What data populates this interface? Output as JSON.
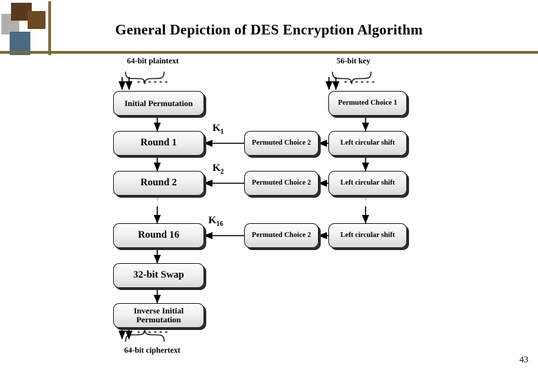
{
  "slide": {
    "title": "General Depiction of DES Encryption Algorithm",
    "page_number": "43"
  },
  "diagram": {
    "type": "flowchart",
    "top_labels": {
      "plaintext": "64-bit plaintext",
      "key": "56-bit key"
    },
    "bottom_labels": {
      "ciphertext": "64-bit ciphertext"
    },
    "left_column": [
      {
        "label": "Initial Permutation"
      },
      {
        "label": "Round 1"
      },
      {
        "label": "Round 2"
      },
      {
        "label": "Round 16"
      },
      {
        "label": "32-bit Swap"
      },
      {
        "label": "Inverse Initial\nPermutation"
      }
    ],
    "middle_column": [
      {
        "label": "Permuted Choice 2"
      },
      {
        "label": "Permuted Choice 2"
      },
      {
        "label": "Permuted Choice 2"
      }
    ],
    "right_column": [
      {
        "label": "Permuted Choice 1"
      },
      {
        "label": "Left circular shift"
      },
      {
        "label": "Left circular shift"
      },
      {
        "label": "Left circular shift"
      }
    ],
    "key_tags": [
      {
        "base": "K",
        "sub": "1"
      },
      {
        "base": "K",
        "sub": "2"
      },
      {
        "base": "K",
        "sub": "16"
      }
    ],
    "colors": {
      "box_fill": "#f1f1f1",
      "box_border": "#1a1a1a",
      "box_shadow": "#2b2b2b",
      "dashed_line": "#bdbdbd",
      "rule": "#7a6a3a"
    }
  }
}
